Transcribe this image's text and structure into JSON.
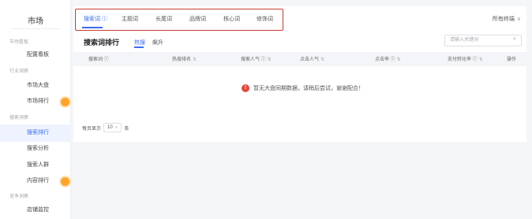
{
  "sidebar": {
    "title": "市场",
    "groups": [
      {
        "label": "市场看板"
      },
      {
        "label": "行业洞察"
      },
      {
        "label": "搜索洞察"
      },
      {
        "label": "竞争洞察"
      }
    ],
    "items": [
      {
        "label": "配置看板"
      },
      {
        "label": "市场大盘"
      },
      {
        "label": "市场排行"
      },
      {
        "label": "搜索排行"
      },
      {
        "label": "搜索分析"
      },
      {
        "label": "搜索人群"
      },
      {
        "label": "内容排行"
      },
      {
        "label": "店铺监控"
      }
    ]
  },
  "top_tabs": [
    {
      "label": "搜索词 ⓘ"
    },
    {
      "label": "主题词"
    },
    {
      "label": "长尾词"
    },
    {
      "label": "品牌词"
    },
    {
      "label": "核心词"
    },
    {
      "label": "修饰词"
    }
  ],
  "top_right": {
    "label": "所有终端",
    "chevron": "∨"
  },
  "panel": {
    "title": "搜索词排行",
    "subtabs": [
      {
        "label": "热搜"
      },
      {
        "label": "飙升"
      }
    ],
    "search_placeholder": "请输入关键词",
    "search_icon": "⌕"
  },
  "table": {
    "columns": [
      {
        "label": "搜索词 ⓘ",
        "sort": ""
      },
      {
        "label": "热搜排名",
        "sort": "⇅"
      },
      {
        "label": "搜索人气 ⓘ",
        "sort": "⇅"
      },
      {
        "label": "点击人气",
        "sort": "⇅"
      },
      {
        "label": "点击率 ⓘ",
        "sort": "⇅"
      },
      {
        "label": "支付转化率 ⓘ",
        "sort": "⇅"
      },
      {
        "label": "操作",
        "sort": ""
      }
    ],
    "empty_icon": "!",
    "empty_message": "暂无大盘同期数据，请稍后尝试，谢谢配合！"
  },
  "pager": {
    "prefix": "每页显示",
    "value": "10",
    "chevron": "∨",
    "suffix": "条"
  },
  "colors": {
    "accent": "#3a6df0",
    "highlight_box": "#c93a31",
    "badge": "#ffa42b",
    "error": "#e5483b"
  }
}
